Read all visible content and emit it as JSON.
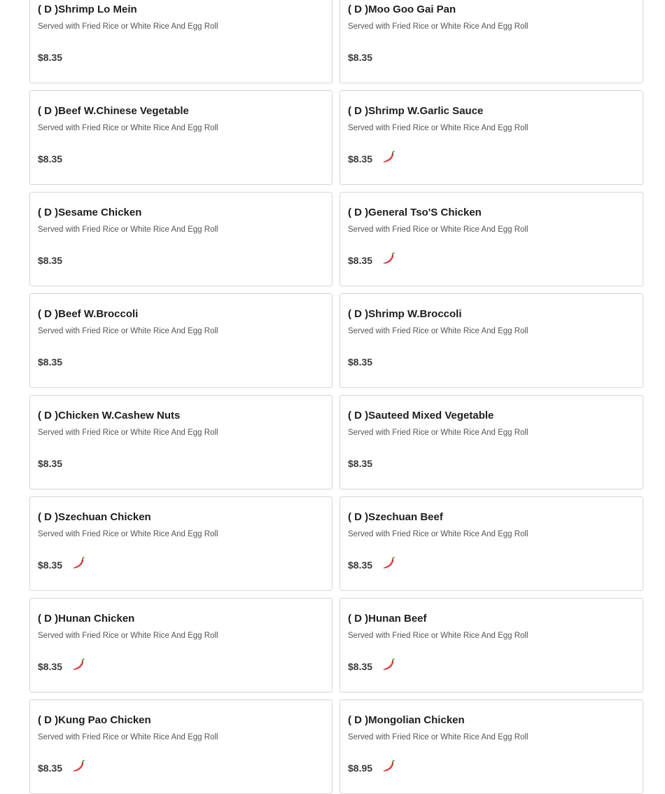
{
  "menu": {
    "items": [
      {
        "name": "( D )Shrimp Lo Mein",
        "description": "Served with Fried Rice or White Rice And Egg Roll",
        "price": "$8.35",
        "spicy": false
      },
      {
        "name": "( D )Moo Goo Gai Pan",
        "description": "Served with Fried Rice or White Rice And Egg Roll",
        "price": "$8.35",
        "spicy": false
      },
      {
        "name": "( D )Beef W.Chinese Vegetable",
        "description": "Served with Fried Rice or White Rice And Egg Roll",
        "price": "$8.35",
        "spicy": false
      },
      {
        "name": "( D )Shrimp W.Garlic Sauce",
        "description": "Served with Fried Rice or White Rice And Egg Roll",
        "price": "$8.35",
        "spicy": true
      },
      {
        "name": "( D )Sesame Chicken",
        "description": "Served with Fried Rice or White Rice And Egg Roll",
        "price": "$8.35",
        "spicy": false
      },
      {
        "name": "( D )General Tso'S Chicken",
        "description": "Served with Fried Rice or White Rice And Egg Roll",
        "price": "$8.35",
        "spicy": true
      },
      {
        "name": "( D )Beef W.Broccoli",
        "description": "Served with Fried Rice or White Rice And Egg Roll",
        "price": "$8.35",
        "spicy": false
      },
      {
        "name": "( D )Shrimp W.Broccoli",
        "description": "Served with Fried Rice or White Rice And Egg Roll",
        "price": "$8.35",
        "spicy": false
      },
      {
        "name": "( D )Chicken W.Cashew Nuts",
        "description": "Served with Fried Rice or White Rice And Egg Roll",
        "price": "$8.35",
        "spicy": false
      },
      {
        "name": "( D )Sauteed Mixed Vegetable",
        "description": "Served with Fried Rice or White Rice And Egg Roll",
        "price": "$8.35",
        "spicy": false
      },
      {
        "name": "( D )Szechuan Chicken",
        "description": "Served with Fried Rice or White Rice And Egg Roll",
        "price": "$8.35",
        "spicy": true
      },
      {
        "name": "( D )Szechuan Beef",
        "description": "Served with Fried Rice or White Rice And Egg Roll",
        "price": "$8.35",
        "spicy": true
      },
      {
        "name": "( D )Hunan Chicken",
        "description": "Served with Fried Rice or White Rice And Egg Roll",
        "price": "$8.35",
        "spicy": true
      },
      {
        "name": "( D )Hunan Beef",
        "description": "Served with Fried Rice or White Rice And Egg Roll",
        "price": "$8.35",
        "spicy": true
      },
      {
        "name": "( D )Kung Pao Chicken",
        "description": "Served with Fried Rice or White Rice And Egg Roll",
        "price": "$8.35",
        "spicy": true
      },
      {
        "name": "( D )Mongolian Chicken",
        "description": "Served with Fried Rice or White Rice And Egg Roll",
        "price": "$8.95",
        "spicy": true
      }
    ],
    "spicy_icon": "chili-pepper-icon",
    "colors": {
      "card_border": "#d6d6d6",
      "pepper_red": "#d8242a",
      "pepper_stem": "#5a9a2a"
    }
  }
}
